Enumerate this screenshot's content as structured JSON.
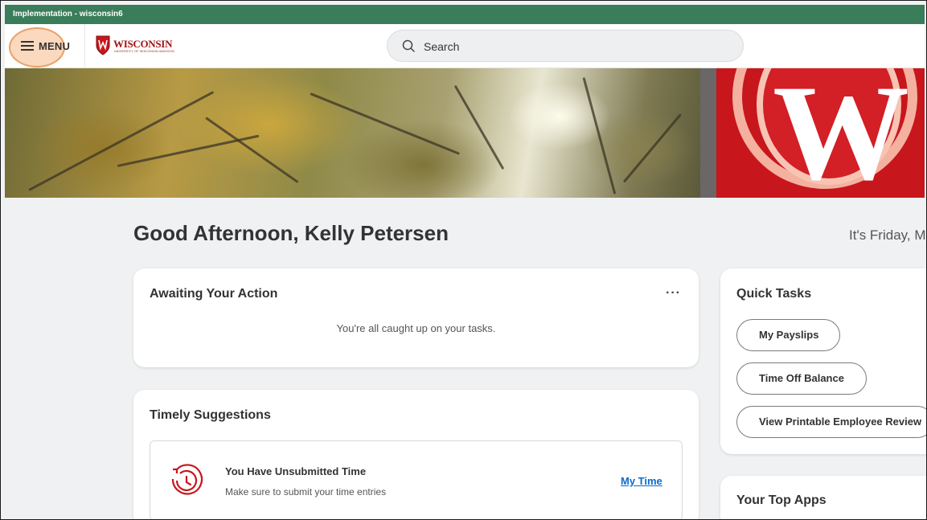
{
  "environment": {
    "label": "Implementation - wisconsin6"
  },
  "topbar": {
    "menu_label": "MENU",
    "logo_text": "WISCONSIN",
    "logo_tagline": "UNIVERSITY OF WISCONSIN-MADISON",
    "search_placeholder": "Search"
  },
  "home": {
    "greeting": "Good Afternoon, Kelly Petersen",
    "date_text": "It's Friday, Ma"
  },
  "awaiting": {
    "title": "Awaiting Your Action",
    "more_label": "···",
    "message": "You're all caught up on your tasks."
  },
  "timely": {
    "title": "Timely Suggestions",
    "item": {
      "title": "You Have Unsubmitted Time",
      "subtitle": "Make sure to submit your time entries",
      "link": "My Time"
    }
  },
  "quick_tasks": {
    "title": "Quick Tasks",
    "items": [
      "My Payslips",
      "Time Off Balance",
      "View Printable Employee Review"
    ]
  },
  "top_apps": {
    "title": "Your Top Apps"
  },
  "colors": {
    "env_bar": "#3a7d5a",
    "brand_red": "#c8161d",
    "link": "#0b6bcb"
  }
}
